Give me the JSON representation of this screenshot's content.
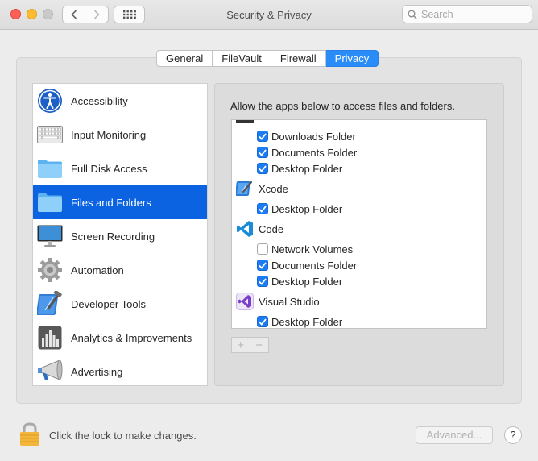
{
  "window": {
    "title": "Security & Privacy",
    "search_placeholder": "Search"
  },
  "tabs": [
    {
      "label": "General",
      "active": false
    },
    {
      "label": "FileVault",
      "active": false
    },
    {
      "label": "Firewall",
      "active": false
    },
    {
      "label": "Privacy",
      "active": true
    }
  ],
  "sidebar": {
    "items": [
      {
        "label": "Accessibility",
        "icon": "accessibility-icon"
      },
      {
        "label": "Input Monitoring",
        "icon": "keyboard-icon"
      },
      {
        "label": "Full Disk Access",
        "icon": "folder-icon"
      },
      {
        "label": "Files and Folders",
        "icon": "folder-icon",
        "selected": true
      },
      {
        "label": "Screen Recording",
        "icon": "display-icon"
      },
      {
        "label": "Automation",
        "icon": "gear-icon"
      },
      {
        "label": "Developer Tools",
        "icon": "hammer-icon"
      },
      {
        "label": "Analytics & Improvements",
        "icon": "bar-chart-icon"
      },
      {
        "label": "Advertising",
        "icon": "megaphone-icon"
      }
    ]
  },
  "content": {
    "description": "Allow the apps below to access files and folders.",
    "rows": [
      {
        "type": "perm",
        "label": "Downloads Folder",
        "checked": true
      },
      {
        "type": "perm",
        "label": "Documents Folder",
        "checked": true
      },
      {
        "type": "perm",
        "label": "Desktop Folder",
        "checked": true
      },
      {
        "type": "app",
        "label": "Xcode",
        "icon": "xcode-icon"
      },
      {
        "type": "perm",
        "label": "Desktop Folder",
        "checked": true
      },
      {
        "type": "app",
        "label": "Code",
        "icon": "vscode-icon"
      },
      {
        "type": "perm",
        "label": "Network Volumes",
        "checked": false
      },
      {
        "type": "perm",
        "label": "Documents Folder",
        "checked": true
      },
      {
        "type": "perm",
        "label": "Desktop Folder",
        "checked": true
      },
      {
        "type": "app",
        "label": "Visual Studio",
        "icon": "visual-studio-icon"
      },
      {
        "type": "perm",
        "label": "Desktop Folder",
        "checked": true
      }
    ],
    "add_label": "+",
    "remove_label": "−"
  },
  "footer": {
    "lock_text": "Click the lock to make changes.",
    "advanced_label": "Advanced...",
    "help_label": "?"
  },
  "colors": {
    "accent": "#2a8cf8",
    "selection": "#0b63e1",
    "checkbox": "#1c7cf4"
  }
}
